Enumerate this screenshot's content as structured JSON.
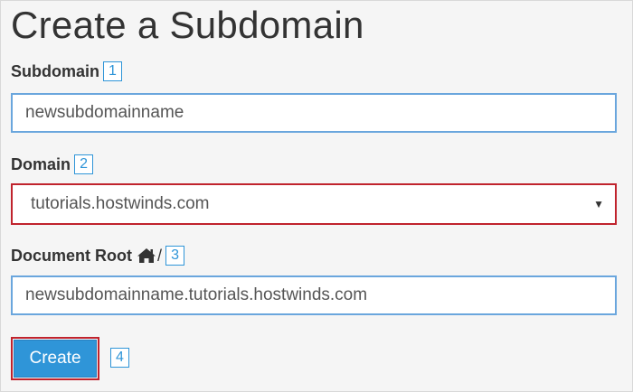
{
  "page": {
    "title": "Create a Subdomain"
  },
  "subdomain": {
    "label": "Subdomain",
    "step": "1",
    "value": "newsubdomainname"
  },
  "domain": {
    "label": "Domain",
    "step": "2",
    "selected": "tutorials.hostwinds.com",
    "caret": "▼"
  },
  "document_root": {
    "label": "Document Root",
    "home_icon": "home-icon",
    "slash": "/",
    "step": "3",
    "value": "newsubdomainname.tutorials.hostwinds.com"
  },
  "actions": {
    "create_label": "Create",
    "step": "4"
  },
  "colors": {
    "accent": "#2f95d8",
    "highlight": "#c0232d",
    "input_border": "#6aa6dd",
    "background": "#f5f5f5"
  }
}
